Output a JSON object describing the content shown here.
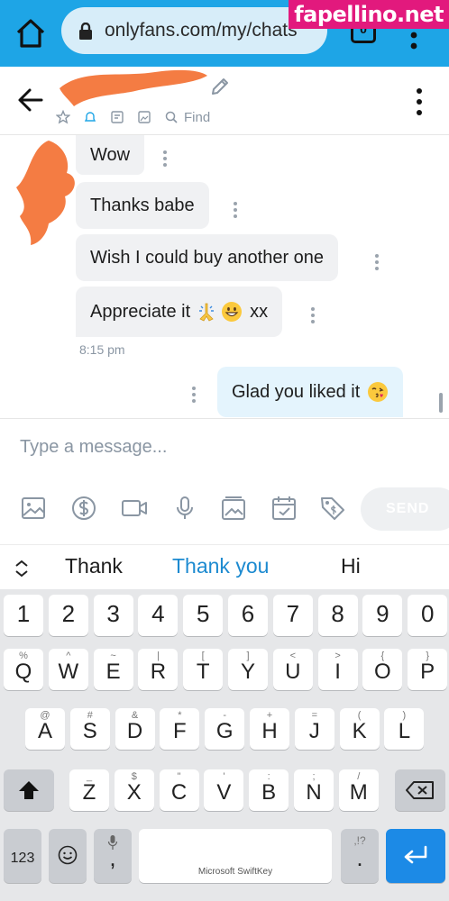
{
  "browser": {
    "url": "onlyfans.com/my/chats",
    "tab_count": "0",
    "watermark": "fapellino.net"
  },
  "chat_header": {
    "find_label": "Find"
  },
  "messages": [
    {
      "text": "Wow",
      "direction": "incoming"
    },
    {
      "text": "Thanks babe",
      "direction": "incoming"
    },
    {
      "text": "Wish I could buy another one",
      "direction": "incoming"
    },
    {
      "text": "Appreciate it",
      "emoji": [
        "folded-hands",
        "grinning-face"
      ],
      "suffix": "xx",
      "direction": "incoming"
    },
    {
      "text": "Glad you liked it",
      "emoji": [
        "face-blowing-kiss"
      ],
      "direction": "outgoing"
    }
  ],
  "timestamp": "8:15 pm",
  "composer": {
    "placeholder": "Type a message...",
    "send_label": "SEND",
    "tools": [
      "image-icon",
      "dollar-icon",
      "video-icon",
      "microphone-icon",
      "gallery-icon",
      "calendar-icon",
      "price-tag-icon"
    ]
  },
  "suggestions": [
    "Thank",
    "Thank you",
    "Hi"
  ],
  "keyboard": {
    "numbers": [
      "1",
      "2",
      "3",
      "4",
      "5",
      "6",
      "7",
      "8",
      "9",
      "0"
    ],
    "row1": [
      [
        "Q",
        "%"
      ],
      [
        "W",
        "^"
      ],
      [
        "E",
        "~"
      ],
      [
        "R",
        "|"
      ],
      [
        "T",
        "["
      ],
      [
        "Y",
        "]"
      ],
      [
        "U",
        "<"
      ],
      [
        "I",
        ">"
      ],
      [
        "O",
        "{"
      ],
      [
        "P",
        "}"
      ]
    ],
    "row2": [
      [
        "A",
        "@"
      ],
      [
        "S",
        "#"
      ],
      [
        "D",
        "&"
      ],
      [
        "F",
        "*"
      ],
      [
        "G",
        "-"
      ],
      [
        "H",
        "+"
      ],
      [
        "J",
        "="
      ],
      [
        "K",
        "("
      ],
      [
        "L",
        ")"
      ]
    ],
    "row3": [
      [
        "Z",
        "_"
      ],
      [
        "X",
        "$"
      ],
      [
        "C",
        "\""
      ],
      [
        "V",
        "'"
      ],
      [
        "B",
        ":"
      ],
      [
        "N",
        ";"
      ],
      [
        "M",
        "/"
      ]
    ],
    "symbols_label": "123",
    "comma_label": ",",
    "period_label": ".",
    "period_sec": ",!?",
    "space_label": "Microsoft SwiftKey"
  },
  "colors": {
    "browser_bar": "#1ea5e6",
    "outgoing_bubble": "#e4f4fd",
    "incoming_bubble": "#f0f1f3",
    "suggestion_primary": "#1c8ad0",
    "enter_key": "#1c8ae6",
    "watermark": "#e2197d"
  }
}
